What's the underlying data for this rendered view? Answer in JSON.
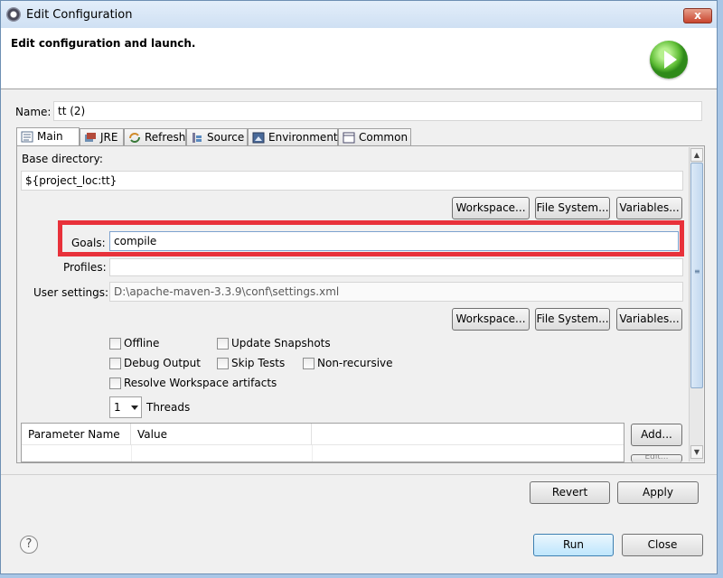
{
  "window": {
    "title": "Edit Configuration",
    "close_glyph": "x"
  },
  "header": {
    "title": "Edit configuration and launch."
  },
  "name": {
    "label": "Name:",
    "value": "tt (2)"
  },
  "tabs": [
    {
      "label": "Main",
      "icon": "main-tab-icon"
    },
    {
      "label": "JRE",
      "icon": "jre-icon"
    },
    {
      "label": "Refresh",
      "icon": "refresh-icon"
    },
    {
      "label": "Source",
      "icon": "source-icon"
    },
    {
      "label": "Environment",
      "icon": "environment-icon"
    },
    {
      "label": "Common",
      "icon": "common-icon"
    }
  ],
  "main": {
    "base_dir_label": "Base directory:",
    "base_dir_value": "${project_loc:tt}",
    "buttons1": {
      "workspace": "Workspace...",
      "filesystem": "File System...",
      "variables": "Variables..."
    },
    "goals_label": "Goals:",
    "goals_value": "compile",
    "profiles_label": "Profiles:",
    "profiles_value": "",
    "user_settings_label": "User settings:",
    "user_settings_value": "D:\\apache-maven-3.3.9\\conf\\settings.xml",
    "buttons2": {
      "workspace": "Workspace...",
      "filesystem": "File System...",
      "variables": "Variables..."
    },
    "checkboxes": {
      "offline": "Offline",
      "update_snapshots": "Update Snapshots",
      "debug_output": "Debug Output",
      "skip_tests": "Skip Tests",
      "non_recursive": "Non-recursive",
      "resolve_workspace": "Resolve Workspace artifacts"
    },
    "threads_value": "1",
    "threads_label": "Threads",
    "table_headers": [
      "Parameter Name",
      "Value"
    ],
    "add_button": "Add...",
    "edit_button": "Edit..."
  },
  "footer": {
    "revert": "Revert",
    "apply": "Apply",
    "run": "Run",
    "close": "Close",
    "help_glyph": "?"
  },
  "colors": {
    "highlight": "#e8313a",
    "accent": "#3c7fb1"
  }
}
